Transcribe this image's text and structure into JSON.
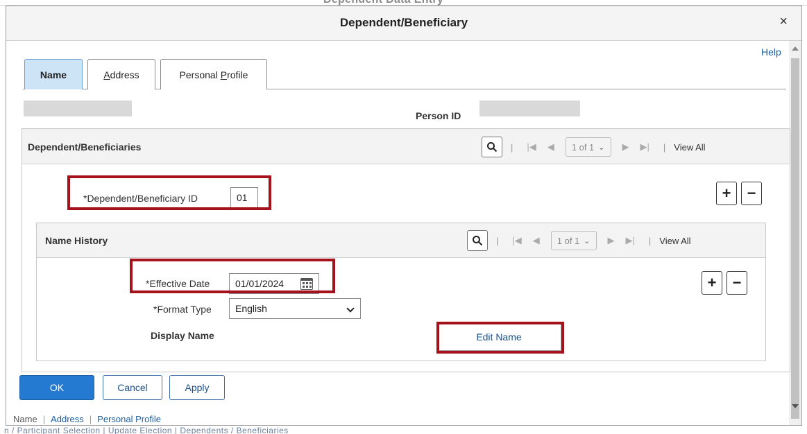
{
  "background": {
    "title_ghost": "Dependent Data Entry",
    "bottom_ghost": "n / Participant Selection  |  Update Election  |  Dependents / Beneficiaries"
  },
  "modal": {
    "title": "Dependent/Beneficiary",
    "close_glyph": "×",
    "help_label": "Help"
  },
  "tabs": [
    {
      "label": "Name",
      "active": true
    },
    {
      "label": "Address",
      "underline": "A",
      "rest": "ddress"
    },
    {
      "label": "Personal Profile",
      "prefix": "Personal ",
      "underline": "P",
      "rest": "rofile"
    }
  ],
  "person": {
    "id_label": "Person ID"
  },
  "dependents_grid": {
    "title": "Dependent/Beneficiaries",
    "page_text": "1 of 1",
    "view_all": "View All",
    "id_label": "*Dependent/Beneficiary ID",
    "id_value": "01"
  },
  "name_history": {
    "title": "Name History",
    "page_text": "1 of 1",
    "view_all": "View All",
    "effective_date_label": "*Effective Date",
    "effective_date_value": "01/01/2024",
    "format_type_label": "*Format Type",
    "format_type_value": "English",
    "display_name_label": "Display Name",
    "edit_name_button": "Edit Name"
  },
  "buttons": {
    "ok": "OK",
    "cancel": "Cancel",
    "apply": "Apply"
  },
  "bottom_links": [
    "Name",
    "Address",
    "Personal Profile"
  ],
  "colors": {
    "primary_button": "#2479d0",
    "highlight_red": "#a5121b",
    "active_tab": "#cde4f7"
  }
}
